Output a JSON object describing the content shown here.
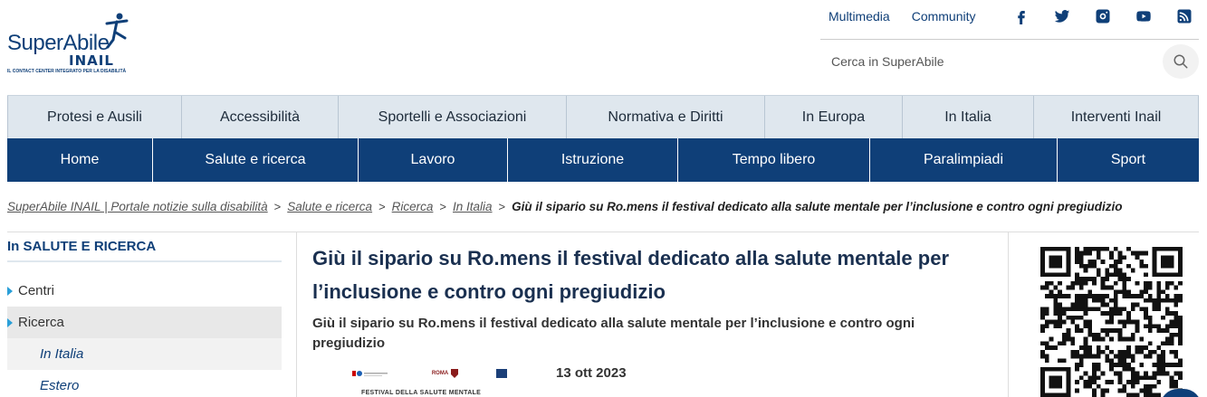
{
  "logo": {
    "name": "SuperAbile",
    "sub": "INAIL",
    "tagline": "IL CONTACT CENTER INTEGRATO PER LA DISABILITÀ"
  },
  "top_links": [
    "Multimedia",
    "Community"
  ],
  "social_icons": [
    "facebook-icon",
    "twitter-icon",
    "instagram-icon",
    "youtube-icon",
    "rss-icon"
  ],
  "search": {
    "placeholder": "Cerca in SuperAbile"
  },
  "nav_secondary": [
    "Protesi e Ausili",
    "Accessibilità",
    "Sportelli e Associazioni",
    "Normativa e Diritti",
    "In Europa",
    "In Italia",
    "Interventi Inail"
  ],
  "nav_primary": [
    "Home",
    "Salute e ricerca",
    "Lavoro",
    "Istruzione",
    "Tempo libero",
    "Paralimpiadi",
    "Sport"
  ],
  "breadcrumb": {
    "items": [
      "SuperAbile INAIL | Portale notizie sulla disabilità",
      "Salute e ricerca",
      "Ricerca",
      "In Italia"
    ],
    "separator": ">",
    "current": "Giù il sipario su Ro.mens il festival dedicato alla salute mentale per l’inclusione e contro ogni pregiudizio"
  },
  "sidebar": {
    "title": "In SALUTE E RICERCA",
    "items": [
      {
        "label": "Centri"
      },
      {
        "label": "Ricerca"
      }
    ],
    "subitems": [
      "In Italia",
      "Estero"
    ]
  },
  "article": {
    "title": "Giù il sipario su Ro.mens il festival dedicato alla salute mentale per l’inclusione e contro ogni pregiudizio",
    "subtitle": "Giù il sipario su Ro.mens il festival dedicato alla salute mentale per l’inclusione e contro ogni pregiudizio",
    "thumb_caption": "FESTIVAL DELLA SALUTE MENTALE",
    "thumb_logo_text": "ROMA",
    "date": "13 ott 2023"
  },
  "colors": {
    "brand_blue": "#0f3f78",
    "nav_secondary_bg": "#dfe7ee",
    "accent_cyan": "#2a9fd8"
  }
}
